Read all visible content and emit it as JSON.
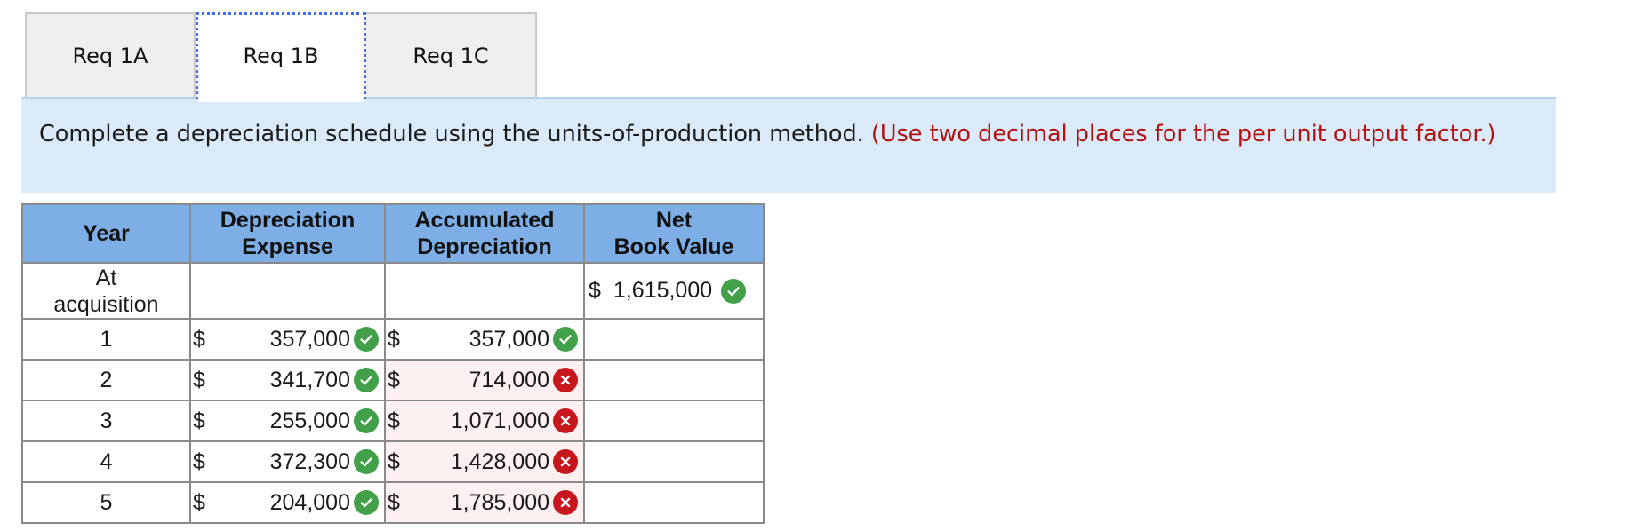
{
  "tabs": [
    {
      "label": "Req 1A",
      "active": false
    },
    {
      "label": "Req 1B",
      "active": true
    },
    {
      "label": "Req 1C",
      "active": false
    }
  ],
  "instruction": {
    "text": "Complete a depreciation schedule using the units-of-production method.",
    "note": "(Use two decimal places for the per unit output factor.)"
  },
  "table": {
    "headers": {
      "year": "Year",
      "dep_line1": "Depreciation",
      "dep_line2": "Expense",
      "acc_line1": "Accumulated",
      "acc_line2": "Depreciation",
      "nbv_line1": "Net",
      "nbv_line2": "Book Value"
    },
    "acquisition": {
      "year_line1": "At",
      "year_line2": "acquisition",
      "nbv_symbol": "$",
      "nbv_value": "1,615,000",
      "nbv_status": "correct"
    },
    "rows": [
      {
        "year": "1",
        "dep_symbol": "$",
        "dep_value": "357,000",
        "dep_status": "correct",
        "acc_symbol": "$",
        "acc_value": "357,000",
        "acc_status": "correct"
      },
      {
        "year": "2",
        "dep_symbol": "$",
        "dep_value": "341,700",
        "dep_status": "correct",
        "acc_symbol": "$",
        "acc_value": "714,000",
        "acc_status": "incorrect"
      },
      {
        "year": "3",
        "dep_symbol": "$",
        "dep_value": "255,000",
        "dep_status": "correct",
        "acc_symbol": "$",
        "acc_value": "1,071,000",
        "acc_status": "incorrect"
      },
      {
        "year": "4",
        "dep_symbol": "$",
        "dep_value": "372,300",
        "dep_status": "correct",
        "acc_symbol": "$",
        "acc_value": "1,428,000",
        "acc_status": "incorrect"
      },
      {
        "year": "5",
        "dep_symbol": "$",
        "dep_value": "204,000",
        "dep_status": "correct",
        "acc_symbol": "$",
        "acc_value": "1,785,000",
        "acc_status": "incorrect"
      }
    ]
  },
  "colors": {
    "header_bg": "#7eaee6",
    "instruction_bg": "#dbeaf8",
    "correct": "#41a048",
    "incorrect": "#c8161d",
    "note_text": "#b01212"
  },
  "icons": {
    "correct": "check-circle-icon",
    "incorrect": "x-circle-icon"
  }
}
